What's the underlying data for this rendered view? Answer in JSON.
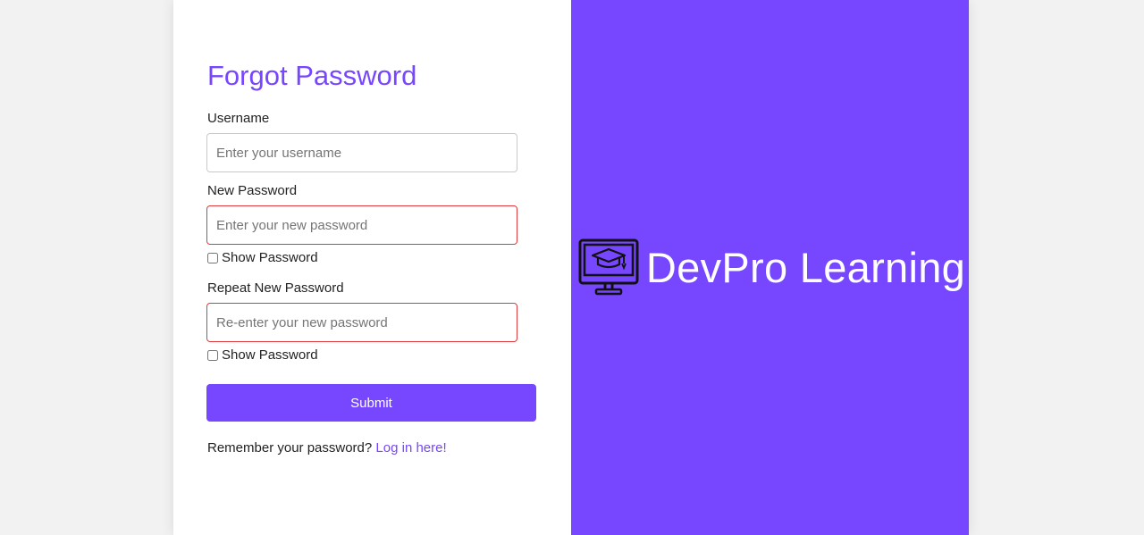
{
  "form": {
    "title": "Forgot Password",
    "username": {
      "label": "Username",
      "placeholder": "Enter your username",
      "value": ""
    },
    "new_password": {
      "label": "New Password",
      "placeholder": "Enter your new password",
      "value": "",
      "show_label": "Show Password",
      "show_checked": false
    },
    "repeat_password": {
      "label": "Repeat New Password",
      "placeholder": "Re-enter your new password",
      "value": "",
      "show_label": "Show Password",
      "show_checked": false
    },
    "submit_label": "Submit",
    "footer_text": "Remember your password?",
    "login_link": "Log in here",
    "footer_suffix": "!"
  },
  "brand": {
    "name": "DevPro Learning",
    "icon": "monitor-graduation-cap-icon"
  },
  "colors": {
    "accent": "#7746ff",
    "error_border": "#e03a3a",
    "background": "#f2f2f2"
  }
}
